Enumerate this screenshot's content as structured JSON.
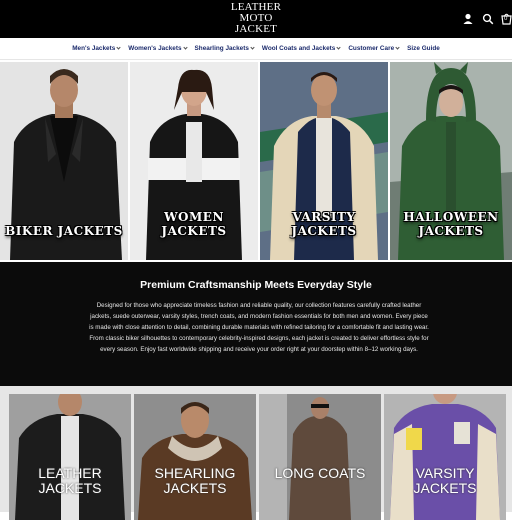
{
  "header": {
    "logo_lines": [
      "LEATHER",
      "MOTO",
      "JACKET"
    ],
    "icons": [
      "user-icon",
      "search-icon",
      "cart-icon"
    ],
    "cart_count": "0"
  },
  "nav": {
    "items": [
      {
        "label": "Men's Jackets",
        "dropdown": true
      },
      {
        "label": "Women's Jackets",
        "dropdown": true
      },
      {
        "label": "Shearling Jackets",
        "dropdown": true
      },
      {
        "label": "Wool Coats and Jackets",
        "dropdown": true
      },
      {
        "label": "Customer Care",
        "dropdown": true
      },
      {
        "label": "Size Guide",
        "dropdown": false
      }
    ]
  },
  "hero": {
    "panels": [
      {
        "caption": "BIKER JACKETS"
      },
      {
        "caption": "WOMEN JACKETS"
      },
      {
        "caption": "VARSITY JACKETS"
      },
      {
        "caption": "HALLOWEEN JACKETS"
      }
    ]
  },
  "band": {
    "title": "Premium Craftsmanship Meets Everyday Style",
    "body": "Designed for those who appreciate timeless fashion and reliable quality, our collection features carefully crafted leather jackets, suede outerwear, varsity styles, trench coats, and modern fashion essentials for both men and women. Every piece is made with close attention to detail, combining durable materials with refined tailoring for a comfortable fit and lasting wear. From classic biker silhouettes to contemporary celebrity-inspired designs, each jacket is created to deliver effortless style for every season. Enjoy fast worldwide shipping and receive your order right at your doorstep within 8–12 working days."
  },
  "cards": [
    {
      "line1": "LEATHER",
      "line2": "JACKETS"
    },
    {
      "line1": "SHEARLING",
      "line2": "JACKETS"
    },
    {
      "line1": "LONG COATS",
      "line2": ""
    },
    {
      "line1": "VARSITY",
      "line2": "JACKETS"
    }
  ],
  "colors": {
    "header_bg": "#000000",
    "nav_text": "#1b2a6b",
    "band_bg": "#0b0b0b"
  }
}
